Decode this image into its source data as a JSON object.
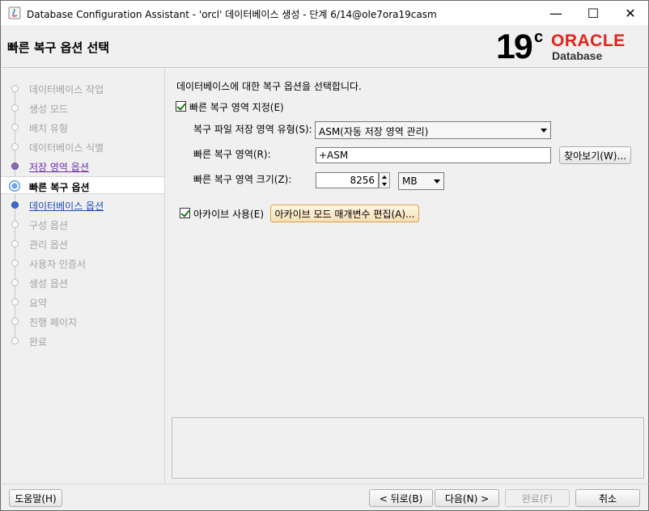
{
  "window": {
    "title": "Database Configuration Assistant - 'orcl' 데이터베이스 생성 - 단계 6/14@ole7ora19casm",
    "minimize_symbol": "—",
    "maximize_symbol": "☐",
    "close_symbol": "✕"
  },
  "header": {
    "page_title": "빠른 복구 옵션 선택",
    "logo": {
      "version": "19",
      "superscript": "c",
      "brand": "ORACLE",
      "product": "Database",
      "brand_color": "#e2231a"
    }
  },
  "steps": [
    {
      "label": "데이터베이스 작업",
      "state": "disabled"
    },
    {
      "label": "생성 모드",
      "state": "disabled"
    },
    {
      "label": "배치 유형",
      "state": "disabled"
    },
    {
      "label": "데이터베이스 식별",
      "state": "disabled"
    },
    {
      "label": "저장 영역 옵션",
      "state": "done"
    },
    {
      "label": "빠른 복구 옵션",
      "state": "current"
    },
    {
      "label": "데이터베이스 옵션",
      "state": "next"
    },
    {
      "label": "구성 옵션",
      "state": "disabled"
    },
    {
      "label": "관리 옵션",
      "state": "disabled"
    },
    {
      "label": "사용자 인증서",
      "state": "disabled"
    },
    {
      "label": "생성 옵션",
      "state": "disabled"
    },
    {
      "label": "요약",
      "state": "disabled"
    },
    {
      "label": "진행 페이지",
      "state": "disabled"
    },
    {
      "label": "완료",
      "state": "disabled"
    }
  ],
  "main": {
    "intro": "데이터베이스에 대한 복구 옵션을 선택합니다.",
    "fra_checkbox": {
      "label": "빠른 복구 영역 지정(E)",
      "checked": true
    },
    "storage_type": {
      "label": "복구 파일 저장 영역 유형(S):",
      "value": "ASM(자동 저장 영역 관리)"
    },
    "fra_location": {
      "label": "빠른 복구 영역(R):",
      "value": "+ASM",
      "browse_label": "찾아보기(W)..."
    },
    "fra_size": {
      "label": "빠른 복구 영역 크기(Z):",
      "value": "8256",
      "unit": "MB"
    },
    "archive_checkbox": {
      "label": "아카이브 사용(E)",
      "checked": true
    },
    "archive_params_button": "아카이브 모드 매개변수 편집(A)..."
  },
  "footer": {
    "help": "도움말(H)",
    "back": "< 뒤로(B)",
    "next": "다음(N) >",
    "finish": "완료(F)",
    "cancel": "취소"
  }
}
